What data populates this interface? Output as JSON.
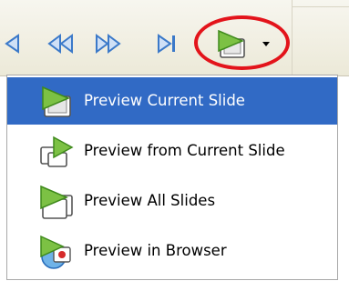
{
  "toolbar": {
    "buttons": [
      {
        "name": "previous-slide-button",
        "icon": "triangle-left-icon"
      },
      {
        "name": "first-slide-button",
        "icon": "double-triangle-left-icon"
      },
      {
        "name": "last-slide-button",
        "icon": "double-triangle-right-icon"
      },
      {
        "name": "next-slide-button",
        "icon": "triangle-bar-right-icon"
      },
      {
        "name": "preview-dropdown-button",
        "icon": "slide-play-icon"
      }
    ],
    "accent_color": "#3b79c9",
    "highlight_color": "#e3141b"
  },
  "menu": {
    "selected_color": "#316ac5",
    "items": [
      {
        "label": "Preview Current Slide",
        "icon": "slide-play-icon",
        "selected": true
      },
      {
        "label": "Preview from Current Slide",
        "icon": "slides-play-forward-icon",
        "selected": false
      },
      {
        "label": "Preview All Slides",
        "icon": "stacked-slides-play-icon",
        "selected": false
      },
      {
        "label": "Preview in Browser",
        "icon": "browser-globe-play-icon",
        "selected": false
      }
    ]
  }
}
